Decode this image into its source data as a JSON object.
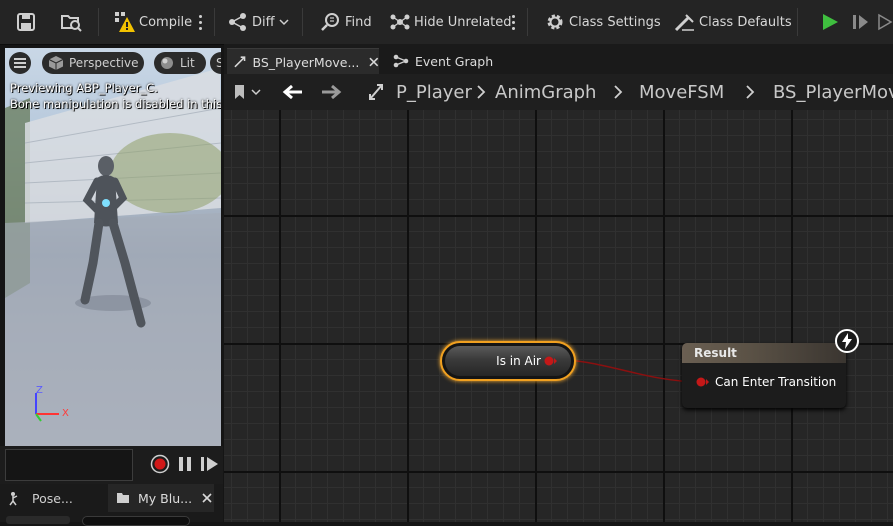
{
  "toolbar": {
    "compile_label": "Compile",
    "diff_label": "Diff",
    "find_label": "Find",
    "hide_unrelated_label": "Hide Unrelated",
    "class_settings_label": "Class Settings",
    "class_defaults_label": "Class Defaults"
  },
  "viewport": {
    "perspective_label": "Perspective",
    "lit_label": "Lit",
    "truncated_label": "S",
    "preview_line1": "Previewing ABP_Player_C.",
    "preview_line2": "Bone manipulation is disabled in this",
    "axis_x": "X",
    "axis_z": "Z"
  },
  "left_tabs": [
    {
      "label": "Pose..."
    },
    {
      "label": "My Blu..."
    }
  ],
  "document_tabs": [
    {
      "label": "BS_PlayerMove..."
    },
    {
      "label": "Event Graph"
    }
  ],
  "breadcrumb": [
    "P_Player",
    "AnimGraph",
    "MoveFSM",
    "BS_PlayerMov"
  ],
  "graph": {
    "is_in_air_label": "Is in Air",
    "result_title": "Result",
    "can_enter_label": "Can Enter Transition"
  },
  "colors": {
    "accent_orange": "#f0a020",
    "pin_red": "#c41818",
    "play_green": "#3fbf3f",
    "record_red": "#d01818"
  }
}
